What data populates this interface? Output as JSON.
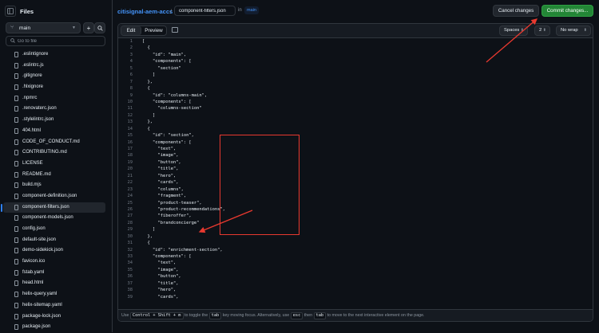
{
  "sidebar": {
    "title": "Files",
    "branch": "main",
    "goto_placeholder": "Go to file",
    "files": [
      ".eslintignore",
      ".eslintrc.js",
      ".gitignore",
      ".hlxignore",
      ".npmrc",
      ".renovaterc.json",
      ".stylelintrc.json",
      "404.html",
      "CODE_OF_CONDUCT.md",
      "CONTRIBUTING.md",
      "LICENSE",
      "README.md",
      "build.mjs",
      "component-definition.json",
      "component-filters.json",
      "component-models.json",
      "config.json",
      "default-site.json",
      "demo-sidekick.json",
      "favicon.ico",
      "fstab.yaml",
      "head.html",
      "helix-query.yaml",
      "helix-sitemap.yaml",
      "package-lock.json",
      "package.json"
    ],
    "active_file": "component-filters.json"
  },
  "topbar": {
    "repo": "citisignal-aem-accs",
    "separator": "/",
    "filename": "component-filters.json",
    "in_label": "in",
    "branch": "main",
    "cancel_label": "Cancel changes",
    "commit_label": "Commit changes..."
  },
  "editor": {
    "tab_edit": "Edit",
    "tab_preview": "Preview",
    "indent_mode": "Spaces",
    "indent_size": "2",
    "wrap_mode": "No wrap",
    "lines": [
      "[",
      "  {",
      "    \"id\": \"main\",",
      "    \"components\": [",
      "      \"section\"",
      "    ]",
      "  },",
      "  {",
      "    \"id\": \"columns-main\",",
      "    \"components\": [",
      "      \"columns-section\"",
      "    ]",
      "  },",
      "  {",
      "    \"id\": \"section\",",
      "    \"components\": [",
      "      \"text\",",
      "      \"image\",",
      "      \"button\",",
      "      \"title\",",
      "      \"hero\",",
      "      \"cards\",",
      "      \"columns\",",
      "      \"fragment\",",
      "      \"product-teaser\",",
      "      \"product-recommendations\",",
      "      \"fiberoffer\",",
      "      \"brandconcierge\"",
      "    ]",
      "  },",
      "  {",
      "    \"id\": \"enrichment-section\",",
      "    \"components\": [",
      "      \"text\",",
      "      \"image\",",
      "      \"button\",",
      "      \"title\",",
      "      \"hero\",",
      "      \"cards\","
    ],
    "footer": {
      "pre": "Use",
      "k1": "Control + Shift + m",
      "t1": "to toggle the",
      "k2": "tab",
      "t2": "key moving focus. Alternatively, use",
      "k3": "esc",
      "t3": "then",
      "k4": "tab",
      "t4": "to move to the next interactive element on the page."
    }
  },
  "colors": {
    "accent": "#4493f8",
    "commit": "#238636",
    "annotation": "#e8392f"
  }
}
